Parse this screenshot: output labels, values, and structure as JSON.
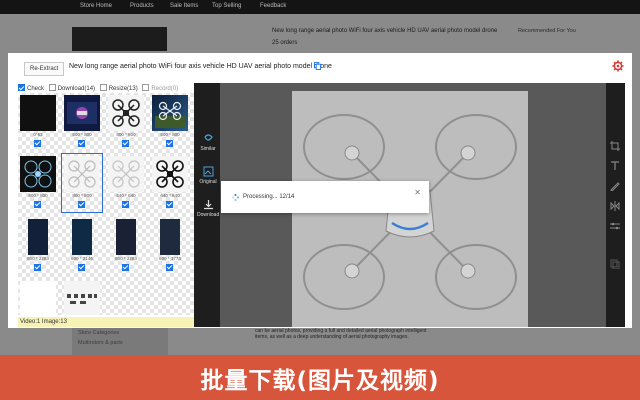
{
  "store": {
    "nav": [
      "Store Home",
      "Products",
      "Sale Items",
      "Top Selling",
      "Feedback"
    ],
    "product_title": "New long range aerial photo WiFi four axis vehicle HD UAV aerial photo model drone",
    "orders": "25 orders",
    "recommended": "Recommended For You",
    "store_categories": "Store Categories",
    "category_item": "Multirotors & parts",
    "description": "can be aerial photos, providing a full and detailed aerial photograph intelligent items, as well as a deep understanding of aerial photography images."
  },
  "modal": {
    "reextract_label": "Re-Extract",
    "title": "New long range aerial photo WiFi four axis vehicle HD UAV aerial photo model drone",
    "toolbar": {
      "check_label": "Check",
      "download_label": "Download(14)",
      "resize_label": "Resize(13)",
      "record_label": "Record(0)"
    },
    "images": [
      {
        "size": "0*53"
      },
      {
        "size": "800 * 800"
      },
      {
        "size": "800 * 800"
      },
      {
        "size": "800 * 800"
      },
      {
        "size": "800 * 800"
      },
      {
        "size": "800 * 800"
      },
      {
        "size": "640 * 640"
      },
      {
        "size": "640 * 640"
      },
      {
        "size": "800 * 2283"
      },
      {
        "size": "800 * 2146"
      },
      {
        "size": "800 * 2283"
      },
      {
        "size": "800 * 1774"
      }
    ],
    "status": "Video:1 Image:13"
  },
  "viewer": {
    "tools": [
      "Similar",
      "Original",
      "Download"
    ],
    "processing": "Processing... 12/14"
  },
  "banner": "批量下载(图片及视频)",
  "colors": {
    "accent": "#1a73e8",
    "banner": "#d7553a",
    "gear": "#d9342b"
  }
}
